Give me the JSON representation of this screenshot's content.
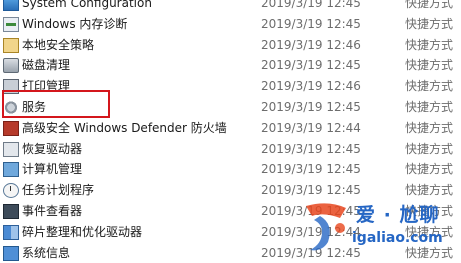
{
  "files": [
    {
      "name": "System Configuration",
      "date": "2019/3/19 12:45",
      "type": "快捷方式",
      "icon": "system-configuration-icon"
    },
    {
      "name": "Windows 内存诊断",
      "date": "2019/3/19 12:45",
      "type": "快捷方式",
      "icon": "memory-diagnostic-icon"
    },
    {
      "name": "本地安全策略",
      "date": "2019/3/19 12:46",
      "type": "快捷方式",
      "icon": "security-policy-icon"
    },
    {
      "name": "磁盘清理",
      "date": "2019/3/19 12:45",
      "type": "快捷方式",
      "icon": "disk-cleanup-icon"
    },
    {
      "name": "打印管理",
      "date": "2019/3/19 12:46",
      "type": "快捷方式",
      "icon": "print-management-icon"
    },
    {
      "name": "服务",
      "date": "2019/3/19 12:45",
      "type": "快捷方式",
      "icon": "services-icon"
    },
    {
      "name": "高级安全 Windows Defender 防火墙",
      "date": "2019/3/19 12:44",
      "type": "快捷方式",
      "icon": "firewall-icon"
    },
    {
      "name": "恢复驱动器",
      "date": "2019/3/19 12:45",
      "type": "快捷方式",
      "icon": "recovery-drive-icon"
    },
    {
      "name": "计算机管理",
      "date": "2019/3/19 12:45",
      "type": "快捷方式",
      "icon": "computer-management-icon"
    },
    {
      "name": "任务计划程序",
      "date": "2019/3/19 12:45",
      "type": "快捷方式",
      "icon": "task-scheduler-icon"
    },
    {
      "name": "事件查看器",
      "date": "2019/3/19 12:45",
      "type": "快捷方式",
      "icon": "event-viewer-icon"
    },
    {
      "name": "碎片整理和优化驱动器",
      "date": "2019/3/19 12:44",
      "type": "快捷方式",
      "icon": "defragment-icon"
    },
    {
      "name": "系统信息",
      "date": "2019/3/19 12:45",
      "type": "快捷方式",
      "icon": "system-information-icon"
    }
  ],
  "highlight_color": "#d4161c",
  "watermark": {
    "line1": "爱 · 尬聊",
    "line2": "igaliao.com",
    "color": "#2566c4",
    "accent": "#e8471e"
  }
}
